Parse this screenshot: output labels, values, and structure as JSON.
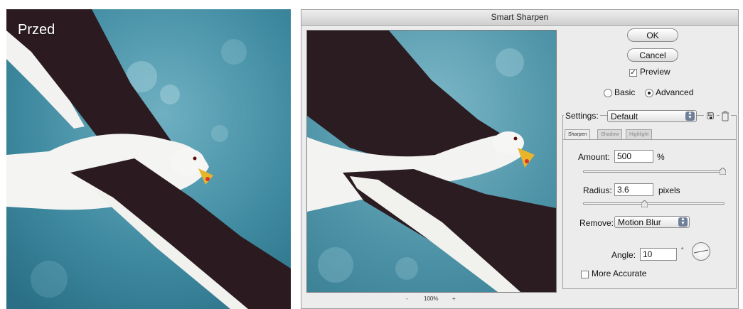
{
  "before_panel": {
    "label": "Przed"
  },
  "dialog": {
    "title": "Smart Sharpen",
    "zoom": {
      "minus": "-",
      "value": "100%",
      "plus": "+"
    },
    "buttons": {
      "ok": "OK",
      "cancel": "Cancel"
    },
    "preview": {
      "label": "Preview",
      "checked": true
    },
    "mode": {
      "basic": "Basic",
      "advanced": "Advanced",
      "selected": "Advanced"
    },
    "settings": {
      "label": "Settings:",
      "value": "Default"
    },
    "tabs": [
      "Sharpen",
      "Shadow",
      "Highlight"
    ],
    "amount": {
      "label": "Amount:",
      "value": "500",
      "unit": "%",
      "slider_fraction": 1.0
    },
    "radius": {
      "label": "Radius:",
      "value": "3.6",
      "unit": "pixels",
      "slider_fraction": 0.45
    },
    "remove": {
      "label": "Remove:",
      "value": "Motion Blur"
    },
    "angle": {
      "label": "Angle:",
      "value": "10",
      "unit": "°"
    },
    "more_accurate": {
      "label": "More Accurate",
      "checked": false
    }
  },
  "colors": {
    "water": "#4a8ea3",
    "wing_dark": "#2b1b20",
    "bird_white": "#f4f4f2",
    "beak": "#e8b52a"
  },
  "icons": [
    "save-settings-icon",
    "delete-settings-icon",
    "stepper-arrows-icon",
    "angle-dial-icon"
  ]
}
